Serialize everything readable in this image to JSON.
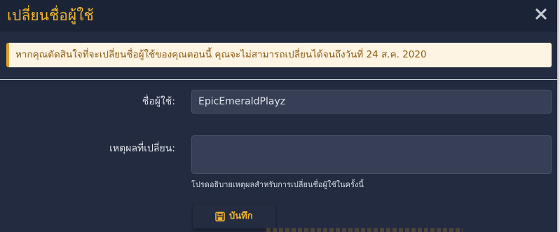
{
  "dialog": {
    "title": "เปลี่ยนชื่อผู้ใช้",
    "close_label": "×"
  },
  "alert": {
    "message": "หากคุณตัดสินใจที่จะเปลี่ยนชื่อผู้ใช้ของคุณตอนนี้ คุณจะไม่สามารถเปลี่ยนได้จนถึงวันที่ 24 ส.ค. 2020",
    "accent_color": "#e0a131"
  },
  "form": {
    "username_label": "ชื่อผู้ใช้:",
    "username_value": "EpicEmeraldPlayz",
    "reason_label": "เหตุผลที่เปลี่ยน:",
    "reason_value": "",
    "reason_help": "โปรดอธิบายเหตุผลสำหรับการเปลี่ยนชื่อผู้ใช้ในครั้งนี้"
  },
  "actions": {
    "save_label": "บันทึก",
    "save_icon": "save-icon"
  },
  "theme": {
    "background": "#232b40",
    "header": "#1b2336",
    "accent": "#f2b62e"
  }
}
